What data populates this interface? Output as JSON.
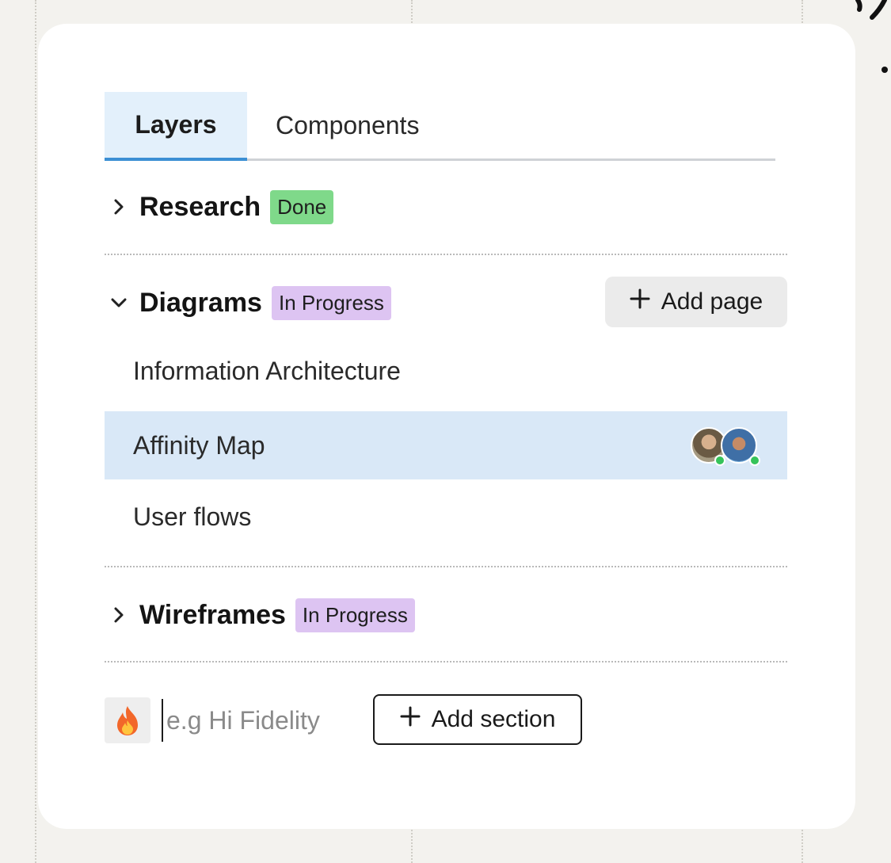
{
  "tabs": {
    "layers": "Layers",
    "components": "Components"
  },
  "sections": {
    "research": {
      "title": "Research",
      "status": "Done"
    },
    "diagrams": {
      "title": "Diagrams",
      "status": "In Progress"
    },
    "wireframes": {
      "title": "Wireframes",
      "status": "In Progress"
    }
  },
  "diagrams_pages": {
    "add_page_label": "Add page",
    "items": [
      "Information Architecture",
      "Affinity Map",
      "User flows"
    ]
  },
  "new_section": {
    "emoji": "🔥",
    "placeholder": "e.g Hi Fidelity",
    "add_label": "Add section"
  },
  "colors": {
    "accent": "#3b8fd4",
    "selected_row": "#d9e8f7",
    "badge_done": "#7fd98a",
    "badge_in_progress": "#ddc4f2"
  },
  "icons": {
    "collapsed": "chevron-right-icon",
    "expanded": "chevron-down-icon",
    "add": "plus-icon",
    "emoji": "fire-icon"
  }
}
